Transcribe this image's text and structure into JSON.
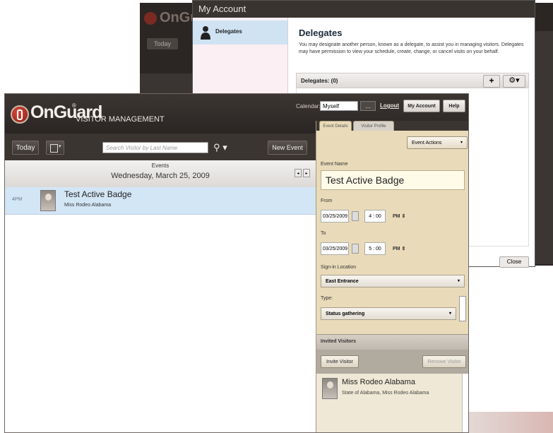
{
  "back_window": {
    "title": "My Account",
    "nav_items": [
      {
        "label": "Delegates"
      }
    ],
    "content_title": "Delegates",
    "description": "You may designate another person, known as a delegate, to assist you in managing visitors. Delegates may have permission to view your schedule, create, change, or cancel visits on your behalf.",
    "delegates_header": "Delegates: (0)",
    "add_icon": "plus-icon",
    "settings_icon": "gear-icon",
    "close_label": "Close"
  },
  "app": {
    "logo_text": "OnGuard",
    "logo_reg": "®",
    "logo_subtitle": "VISITOR MANAGEMENT",
    "calendar_label": "Calendar:",
    "calendar_value": "Myself",
    "calendar_dots": "...",
    "logout_label": "Logout",
    "my_account_label": "My Account",
    "help_label": "Help"
  },
  "toolbar": {
    "today_label": "Today",
    "search_placeholder": "Search Visitor by Last Name",
    "new_event_label": "New Event"
  },
  "events": {
    "title": "Events",
    "date": "Wednesday, March 25, 2009",
    "rows": [
      {
        "time": "4PM",
        "name": "Test Active Badge",
        "subtitle": "Miss Rodeo Alabama"
      }
    ]
  },
  "panel": {
    "tabs": [
      "Event Details",
      "Visitor Profile"
    ],
    "event_actions_label": "Event Actions",
    "event_name_label": "Event Name",
    "event_name_value": "Test Active Badge",
    "from_label": "From",
    "from_date": "03/25/2009",
    "from_time": "4 : 00",
    "from_ampm": "PM",
    "to_label": "To",
    "to_date": "03/25/2009",
    "to_time": "5 : 00",
    "to_ampm": "PM",
    "signin_label": "Sign-in Location",
    "signin_value": "East Entrance",
    "type_label": "Type:",
    "type_value": "Status gathering",
    "invited_label": "Invited Visitors",
    "invite_button": "Invite Visitor",
    "remove_button": "Remove Visitor",
    "visitors": [
      {
        "name": "Miss Rodeo Alabama",
        "subtitle": "State of Alabama, Miss Rodeo Alabama"
      }
    ]
  },
  "colors": {
    "header_bg": "#2a2523",
    "panel_bg": "#e9dbb9",
    "selected_row": "#d3e6f6"
  }
}
